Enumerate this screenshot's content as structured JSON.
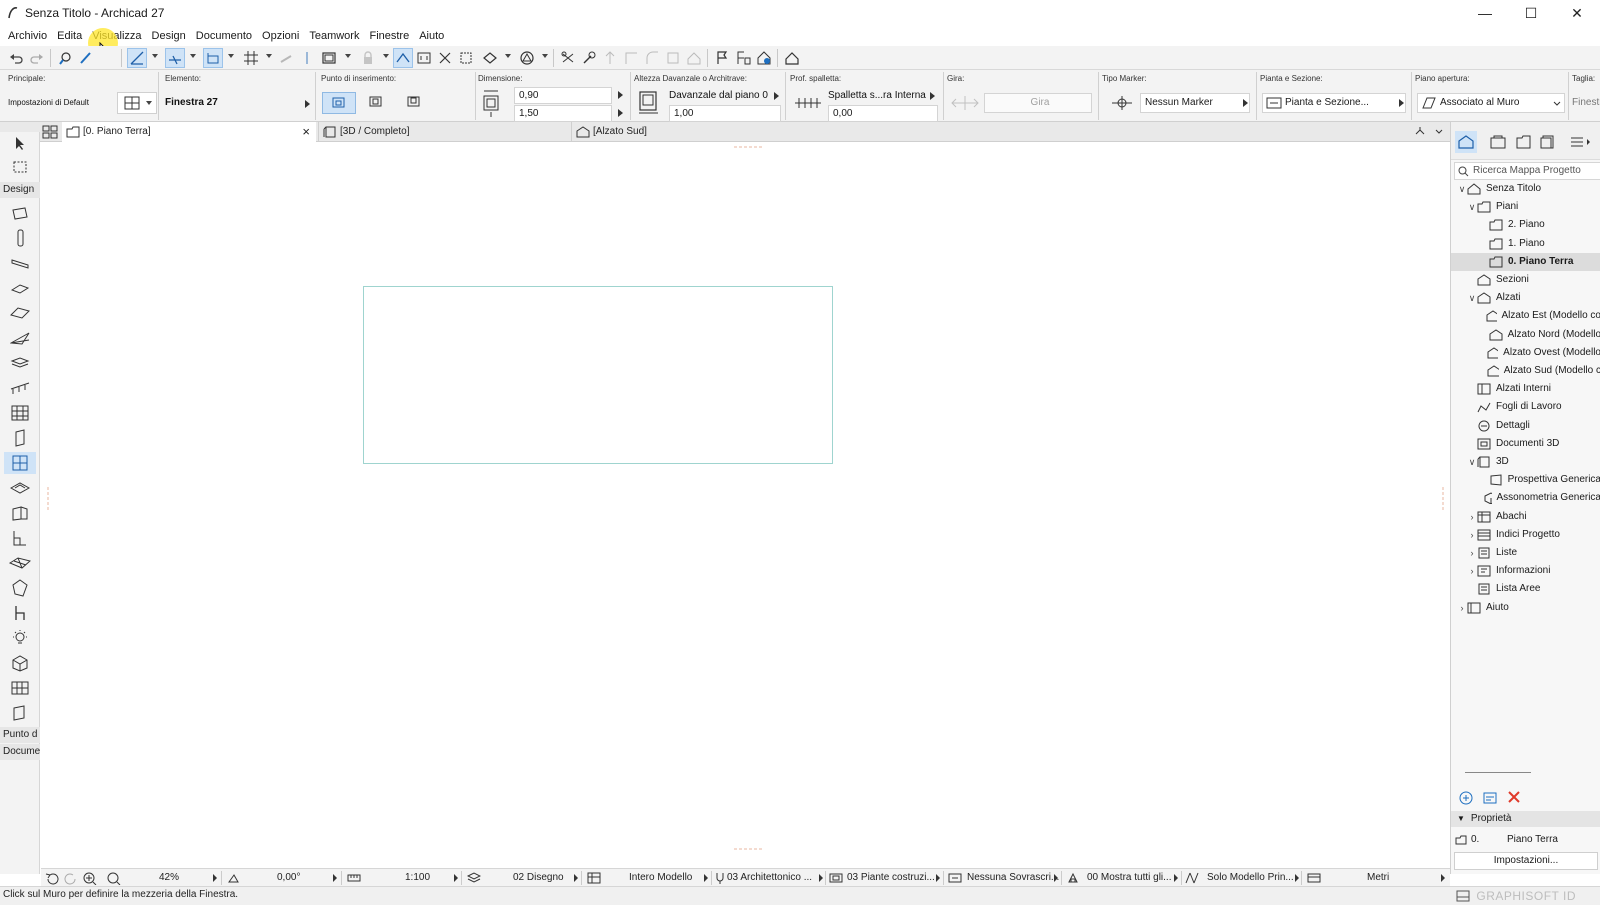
{
  "window": {
    "title": "Senza Titolo - Archicad 27",
    "minimize": "—",
    "maximize": "☐",
    "close": "✕"
  },
  "menu": [
    "Archivio",
    "Edita",
    "Visualizza",
    "Design",
    "Documento",
    "Opzioni",
    "Teamwork",
    "Finestre",
    "Aiuto"
  ],
  "infobox": {
    "principale_label": "Principale:",
    "principale_value": "Impostazioni di Default",
    "elemento_label": "Elemento:",
    "elemento_value": "Finestra 27",
    "punto_label": "Punto di inserimento:",
    "dimensione_label": "Dimensione:",
    "width": "0,90",
    "height": "1,50",
    "altezza_label": "Altezza Davanzale o Architrave:",
    "altezza_value": "Davanzale dal piano 0",
    "altezza_num": "1,00",
    "spalletta_label": "Prof. spalletta:",
    "spalletta_value": "Spalletta s...ra Interna",
    "spalletta_num": "0,00",
    "gira_label": "Gira:",
    "gira_button": "Gira",
    "marker_label": "Tipo Marker:",
    "marker_value": "Nessun Marker",
    "pianta_label": "Pianta e Sezione:",
    "pianta_value": "Pianta e Sezione...",
    "apertura_label": "Piano apertura:",
    "apertura_value": "Associato al Muro",
    "taglia_label": "Taglia:",
    "taglia_value": "Finestr"
  },
  "tabs": {
    "plan": "[0. Piano Terra]",
    "view3d": "[3D / Completo]",
    "elev": "[Alzato Sud]",
    "close": "×"
  },
  "toolbox": {
    "design": "Design",
    "punto": "Punto d",
    "docume": "Docume"
  },
  "navigator": {
    "search_placeholder": "Ricerca Mappa Progetto",
    "tree": [
      {
        "label": "Senza Titolo",
        "toggle": "∨"
      },
      {
        "label": "Piani",
        "toggle": "∨"
      },
      {
        "label": "2. Piano",
        "toggle": ""
      },
      {
        "label": "1. Piano",
        "toggle": ""
      },
      {
        "label": "0. Piano Terra",
        "toggle": ""
      },
      {
        "label": "Sezioni",
        "toggle": ""
      },
      {
        "label": "Alzati",
        "toggle": "∨"
      },
      {
        "label": "Alzato Est (Modello co",
        "toggle": ""
      },
      {
        "label": "Alzato Nord (Modello",
        "toggle": ""
      },
      {
        "label": "Alzato Ovest (Modello",
        "toggle": ""
      },
      {
        "label": "Alzato Sud (Modello c",
        "toggle": ""
      },
      {
        "label": "Alzati Interni",
        "toggle": ""
      },
      {
        "label": "Fogli di Lavoro",
        "toggle": ""
      },
      {
        "label": "Dettagli",
        "toggle": ""
      },
      {
        "label": "Documenti 3D",
        "toggle": ""
      },
      {
        "label": "3D",
        "toggle": "∨"
      },
      {
        "label": "Prospettiva Generica",
        "toggle": ""
      },
      {
        "label": "Assonometria Generica",
        "toggle": ""
      },
      {
        "label": "Abachi",
        "toggle": "›"
      },
      {
        "label": "Indici Progetto",
        "toggle": "›"
      },
      {
        "label": "Liste",
        "toggle": "›"
      },
      {
        "label": "Informazioni",
        "toggle": "›"
      },
      {
        "label": "Lista Aree",
        "toggle": ""
      },
      {
        "label": "Aiuto",
        "toggle": "›"
      }
    ],
    "properties_title": "Proprietà",
    "prop_id": "0.",
    "prop_name": "Piano Terra",
    "settings_button": "Impostazioni..."
  },
  "quickbar": {
    "zoom": "42%",
    "angle": "0,00°",
    "scale": "1:100",
    "layer": "02 Disegno",
    "model": "Intero Modello",
    "pen": "03 Architettonico ...",
    "mvo": "03 Piante costruzi...",
    "override": "Nessuna Sovrascri...",
    "renovation": "00 Mostra tutti gli...",
    "structure": "Solo Modello Prin...",
    "units": "Metri"
  },
  "status": {
    "message": "Click sul Muro per definire la mezzeria della Finestra.",
    "brand": "GRAPHISOFT ID"
  }
}
